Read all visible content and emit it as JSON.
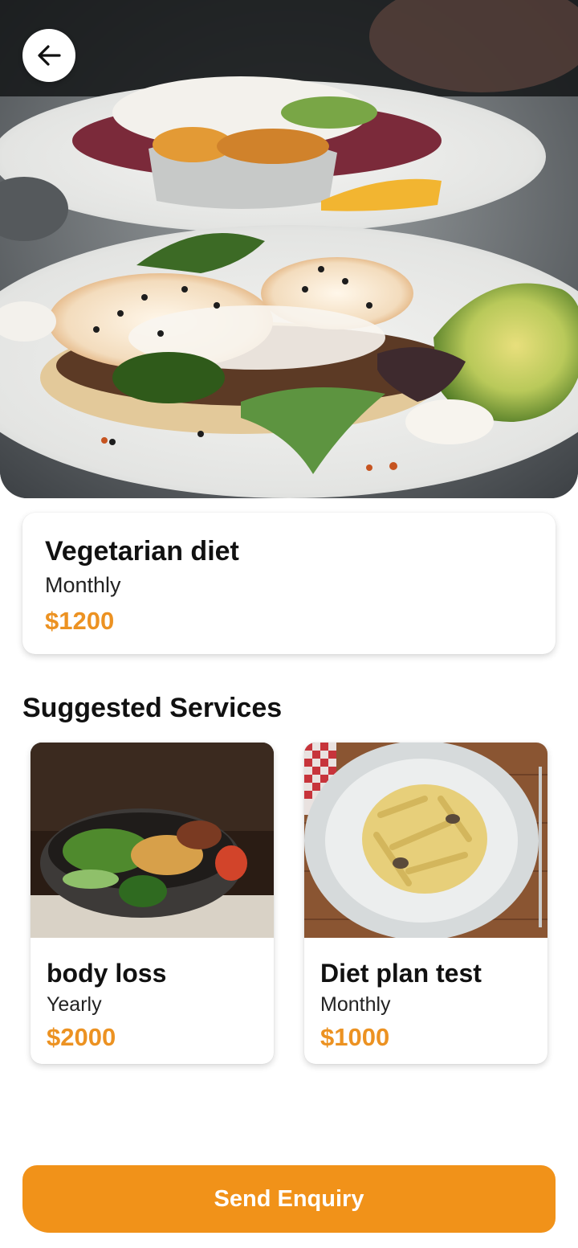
{
  "header": {
    "back_icon": "arrow-left-icon"
  },
  "plan": {
    "title": "Vegetarian diet",
    "period": "Monthly",
    "price": "$1200"
  },
  "suggested": {
    "title": "Suggested Services",
    "items": [
      {
        "title": "body loss",
        "period": "Yearly",
        "price": "$2000"
      },
      {
        "title": "Diet plan test",
        "period": "Monthly",
        "price": "$1000"
      }
    ]
  },
  "cta": {
    "label": "Send Enquiry"
  },
  "colors": {
    "accent": "#f19219",
    "price": "#ec9222"
  }
}
